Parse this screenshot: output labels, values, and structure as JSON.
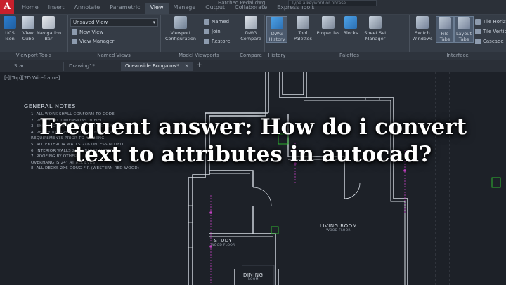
{
  "app": {
    "logo": "A",
    "title": "Hatched Pedal.dwg",
    "search_placeholder": "Type a keyword or phrase"
  },
  "ribbon_tabs": [
    "Home",
    "Insert",
    "Annotate",
    "Parametric",
    "View",
    "Manage",
    "Output",
    "Collaborate",
    "Express Tools"
  ],
  "ribbon_active_tab": "View",
  "ribbon": {
    "viewport_tools": {
      "label": "Viewport Tools",
      "items": [
        "UCS Icon",
        "View Cube",
        "Navigation Bar"
      ]
    },
    "named_views": {
      "label": "Named Views",
      "select_value": "Unsaved View",
      "new_view": "New View",
      "view_manager": "View Manager"
    },
    "model_viewports": {
      "label": "Model Viewports",
      "viewport_config": "Viewport Configuration",
      "named": "Named",
      "join": "Join",
      "restore": "Restore"
    },
    "compare": {
      "label": "Compare",
      "dwg_compare": "DWG Compare"
    },
    "history": {
      "label": "History",
      "dwg_history": "DWG History"
    },
    "palettes": {
      "label": "Palettes",
      "items": [
        "Tool Palettes",
        "Properties",
        "Blocks",
        "Sheet Set Manager"
      ]
    },
    "interface": {
      "label": "Interface",
      "items": [
        "Switch Windows",
        "File Tabs",
        "Layout Tabs"
      ],
      "right_items": [
        "Tile Horizontally",
        "Tile Vertically",
        "Cascade"
      ]
    }
  },
  "doc_tabs": [
    "Start",
    "Drawing1*",
    "Oceanside Bungalow*"
  ],
  "doc_tab_active": "Oceanside Bungalow*",
  "doc_tab_close": "✕",
  "doc_tab_add": "+",
  "view_label": "[-][Top][2D Wireframe]",
  "general_notes": {
    "title": "GENERAL NOTES",
    "items": [
      "1. ALL WORK SHALL CONFORM TO CODE",
      "2. VERIFY ALL DIMENSIONS IN FIELD",
      "3. EXISTING CONDITIONS PRIOR TO BUILDING",
      "4. VERIFY ROUGH OPENINGS AND FRAMING",
      "   REQUIREMENTS PRIOR TO FRAMING",
      "5. ALL EXTERIOR WALLS 2X6 UNLESS NOTED",
      "6. INTERIOR WALLS 2X4 UNLESS NOTED",
      "7. ROOFING BY OTHERS",
      "   OVERHANG IS 24\" AT ALL EVES",
      "8. ALL DECKS 2X6 DOUG FIR (WESTERN RED WOOD)"
    ]
  },
  "rooms": [
    {
      "name": "STUDY",
      "sub": "WOOD FLOOR"
    },
    {
      "name": "LIVING ROOM",
      "sub": "WOOD FLOOR"
    },
    {
      "name": "DINING",
      "sub": "ROOM"
    }
  ],
  "headline": "Frequent answer: How do i convert text to attributes in autocad?",
  "colors": {
    "background": "#1d2128",
    "accent_red": "#c8202c",
    "drawing_lines": "#d7dde4",
    "dim_magenta": "#c040c0",
    "dim_green": "#32c832"
  }
}
